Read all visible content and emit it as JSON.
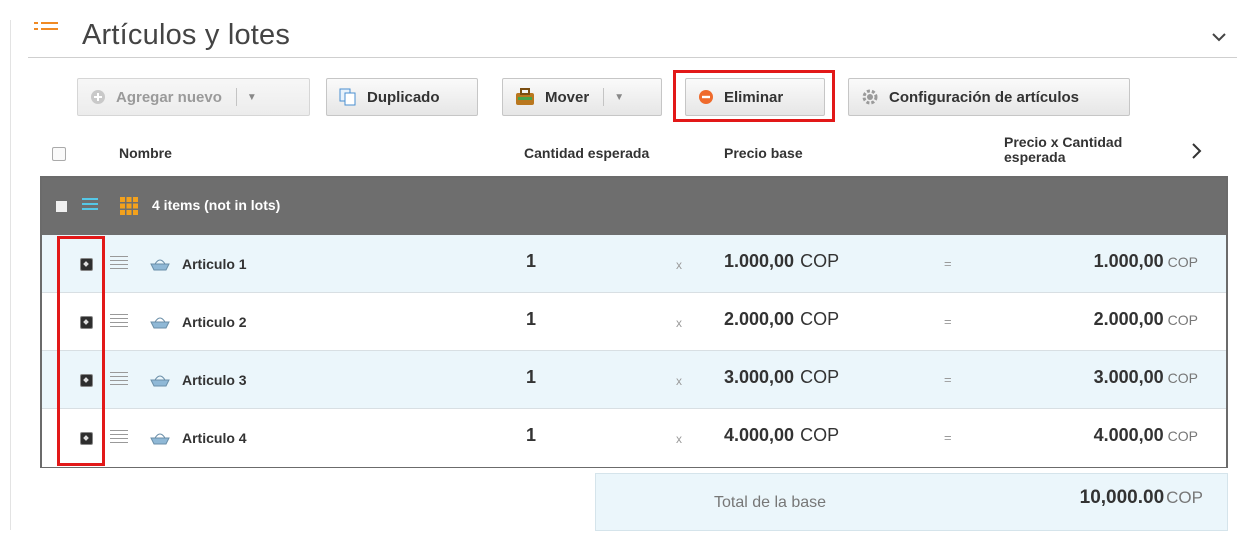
{
  "section": {
    "title": "Artículos y lotes"
  },
  "toolbar": {
    "add_new": "Agregar nuevo",
    "duplicate": "Duplicado",
    "move": "Mover",
    "delete": "Eliminar",
    "item_settings": "Configuración de artículos"
  },
  "columns": {
    "name": "Nombre",
    "expected_qty": "Cantidad esperada",
    "base_price": "Precio base",
    "price_x_qty_line1": "Precio x Cantidad",
    "price_x_qty_line2": "esperada"
  },
  "group": {
    "label": "4 items (not in lots)"
  },
  "rows": [
    {
      "name": "Articulo 1",
      "qty": "1",
      "x": "x",
      "price": "1.000,00",
      "price_cur": "COP",
      "eq": "=",
      "total": "1.000,00",
      "total_cur": "COP"
    },
    {
      "name": "Articulo 2",
      "qty": "1",
      "x": "x",
      "price": "2.000,00",
      "price_cur": "COP",
      "eq": "=",
      "total": "2.000,00",
      "total_cur": "COP"
    },
    {
      "name": "Articulo 3",
      "qty": "1",
      "x": "x",
      "price": "3.000,00",
      "price_cur": "COP",
      "eq": "=",
      "total": "3.000,00",
      "total_cur": "COP"
    },
    {
      "name": "Articulo 4",
      "qty": "1",
      "x": "x",
      "price": "4.000,00",
      "price_cur": "COP",
      "eq": "=",
      "total": "4.000,00",
      "total_cur": "COP"
    }
  ],
  "summary": {
    "label": "Total de la base",
    "value": "10,000.00",
    "currency": "COP"
  },
  "colors": {
    "accent_orange": "#f08a24",
    "highlight_red": "#e21818",
    "group_bar": "#6e6e6e",
    "row_alt": "#ebf6fb"
  },
  "icons": [
    "list-icon",
    "chevron-down-icon",
    "plus-circle-icon",
    "duplicate-icon",
    "briefcase-icon",
    "minus-circle-icon",
    "gear-icon",
    "chevron-right-icon",
    "drag-handle-icon",
    "item-icon",
    "grid-icon"
  ]
}
